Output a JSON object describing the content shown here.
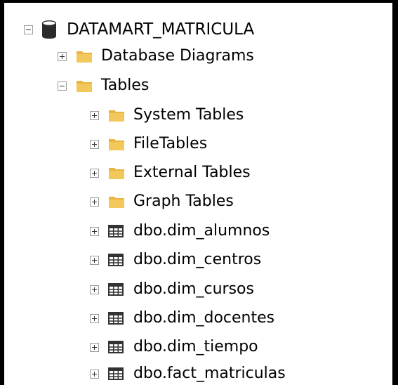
{
  "tree": {
    "database": {
      "label": "DATAMART_MATRICULA",
      "icon": "database-icon",
      "state": "expanded"
    },
    "database_diagrams": {
      "label": "Database Diagrams",
      "icon": "folder-icon",
      "state": "collapsed"
    },
    "tables": {
      "label": "Tables",
      "icon": "folder-icon",
      "state": "expanded",
      "folders": [
        {
          "label": "System Tables",
          "icon": "folder-icon"
        },
        {
          "label": "FileTables",
          "icon": "folder-icon"
        },
        {
          "label": "External Tables",
          "icon": "folder-icon"
        },
        {
          "label": "Graph Tables",
          "icon": "folder-icon"
        }
      ],
      "items": [
        {
          "label": "dbo.dim_alumnos",
          "icon": "table-icon"
        },
        {
          "label": "dbo.dim_centros",
          "icon": "table-icon"
        },
        {
          "label": "dbo.dim_cursos",
          "icon": "table-icon"
        },
        {
          "label": "dbo.dim_docentes",
          "icon": "table-icon"
        },
        {
          "label": "dbo.dim_tiempo",
          "icon": "table-icon"
        },
        {
          "label": "dbo.fact_matriculas",
          "icon": "table-icon"
        }
      ]
    }
  },
  "colors": {
    "folder": "#f2c75c",
    "folder_tab": "#e8b640",
    "database": "#2b2b2b",
    "table_grid": "#333333",
    "expander_border": "#9a9a9a"
  }
}
